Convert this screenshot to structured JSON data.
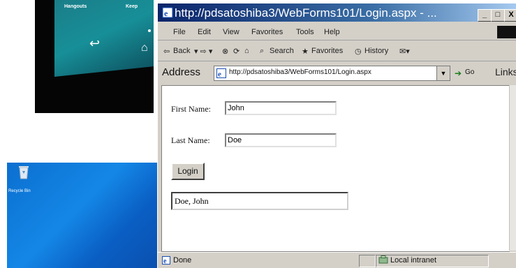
{
  "phone": {
    "labels": [
      "Hangouts",
      "Keep"
    ],
    "nav": {
      "back": "back-icon",
      "home": "home-icon"
    }
  },
  "desktop": {
    "icon_label": "Recycle Bin",
    "colors": {
      "background": "#1487e6"
    }
  },
  "browser": {
    "title": "http://pdsatoshiba3/WebForms101/Login.aspx - ...",
    "window_controls": {
      "minimize": "_",
      "maximize": "□",
      "close": "X"
    },
    "menu": [
      "File",
      "Edit",
      "View",
      "Favorites",
      "Tools",
      "Help"
    ],
    "toolbar": {
      "back": "Back",
      "search": "Search",
      "favorites": "Favorites",
      "history": "History"
    },
    "address": {
      "label": "Address",
      "value": "http://pdsatoshiba3/WebForms101/Login.aspx",
      "go": "Go",
      "links": "Links"
    },
    "status": {
      "text": "Done",
      "zone": "Local intranet"
    }
  },
  "form": {
    "first_name_label": "First Name:",
    "first_name_value": "John",
    "last_name_label": "Last Name:",
    "last_name_value": "Doe",
    "login_button": "Login",
    "result": "Doe, John"
  }
}
